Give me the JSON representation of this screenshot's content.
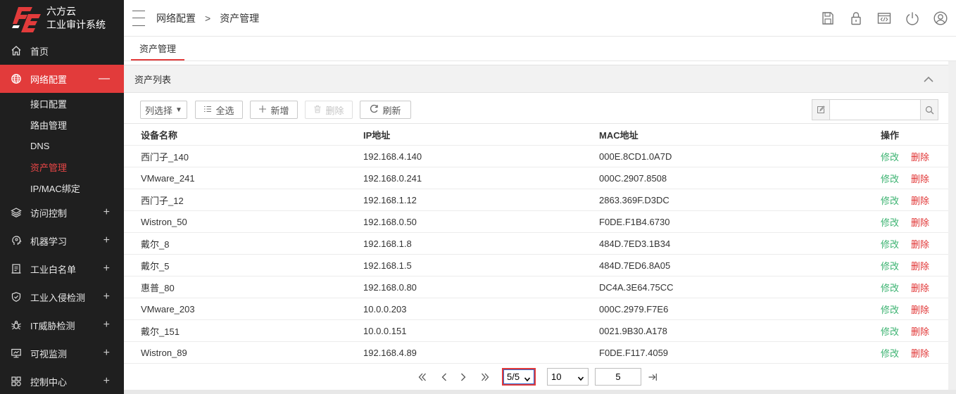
{
  "brand": {
    "logo_glyph": "6E",
    "line1": "六方云",
    "line2": "工业审计系统",
    "accent": "#e23b3b"
  },
  "sidebar": {
    "items": [
      {
        "label": "首页",
        "icon": "home-icon",
        "toggle": ""
      },
      {
        "label": "网络配置",
        "icon": "globe-icon",
        "toggle": "—",
        "active": true
      },
      {
        "label": "访问控制",
        "icon": "layers-icon",
        "toggle": "+"
      },
      {
        "label": "机器学习",
        "icon": "brain-icon",
        "toggle": "+"
      },
      {
        "label": "工业白名单",
        "icon": "list-document-icon",
        "toggle": "+"
      },
      {
        "label": "工业入侵检测",
        "icon": "shield-icon",
        "toggle": "+"
      },
      {
        "label": "IT威胁检测",
        "icon": "bug-icon",
        "toggle": "+"
      },
      {
        "label": "可视监测",
        "icon": "monitor-icon",
        "toggle": "+"
      },
      {
        "label": "控制中心",
        "icon": "control-center-icon",
        "toggle": "+"
      }
    ],
    "sub_items": [
      {
        "label": "接口配置"
      },
      {
        "label": "路由管理"
      },
      {
        "label": "DNS"
      },
      {
        "label": "资产管理",
        "current": true
      },
      {
        "label": "IP/MAC绑定"
      }
    ]
  },
  "header": {
    "breadcrumb": [
      "网络配置",
      ">",
      "资产管理"
    ],
    "tools": [
      "save-icon",
      "lock-icon",
      "code-window-icon",
      "power-icon",
      "user-icon"
    ]
  },
  "tabs": [
    {
      "label": "资产管理",
      "active": true
    }
  ],
  "panel": {
    "title": "资产列表",
    "toolbar": {
      "column_select": "列选择",
      "select_all": "全选",
      "add": "新增",
      "delete": "删除",
      "refresh": "刷新"
    },
    "search": {
      "value": "",
      "placeholder": ""
    }
  },
  "table": {
    "columns": [
      "设备名称",
      "IP地址",
      "MAC地址",
      "操作"
    ],
    "edit_label": "修改",
    "delete_label": "删除",
    "rows": [
      [
        "西门子_140",
        "192.168.4.140",
        "000E.8CD1.0A7D"
      ],
      [
        "VMware_241",
        "192.168.0.241",
        "000C.2907.8508"
      ],
      [
        "西门子_12",
        "192.168.1.12",
        "2863.369F.D3DC"
      ],
      [
        "Wistron_50",
        "192.168.0.50",
        "F0DE.F1B4.6730"
      ],
      [
        "戴尔_8",
        "192.168.1.8",
        "484D.7ED3.1B34"
      ],
      [
        "戴尔_5",
        "192.168.1.5",
        "484D.7ED6.8A05"
      ],
      [
        "惠普_80",
        "192.168.0.80",
        "DC4A.3E64.75CC"
      ],
      [
        "VMware_203",
        "10.0.0.203",
        "000C.2979.F7E6"
      ],
      [
        "戴尔_151",
        "10.0.0.151",
        "0021.9B30.A178"
      ],
      [
        "Wistron_89",
        "192.168.4.89",
        "F0DE.F117.4059"
      ]
    ],
    "edit_color": "#3cb371",
    "delete_color": "#e03333"
  },
  "pagination": {
    "page_select": "5/5",
    "page_size": "10",
    "jump_value": "5"
  }
}
